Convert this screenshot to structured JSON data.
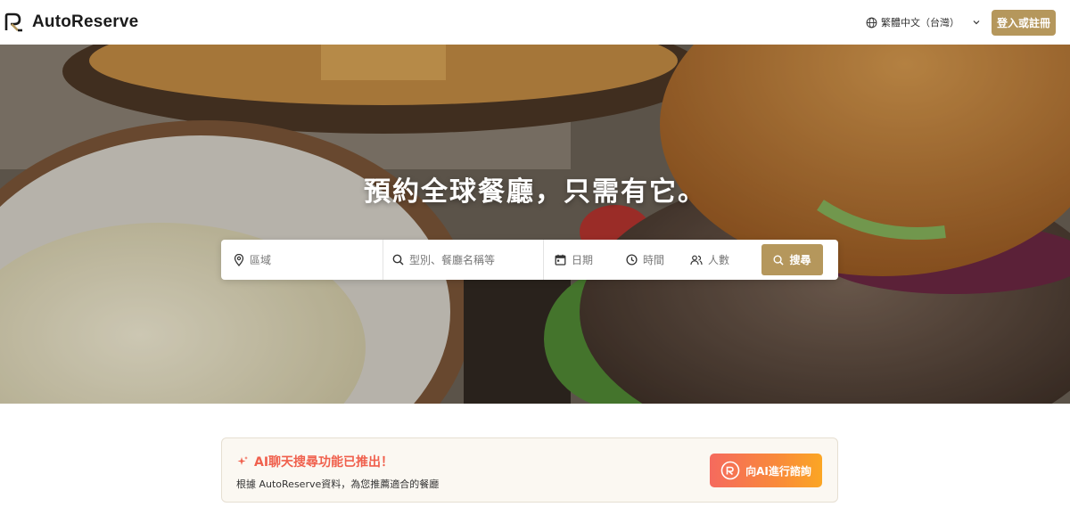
{
  "header": {
    "brand": "AutoReserve",
    "language": "繁體中文（台灣）",
    "login_label": "登入或註冊"
  },
  "hero": {
    "title": "預約全球餐廳，只需有它。"
  },
  "search": {
    "area_placeholder": "區域",
    "type_placeholder": "型別、餐廳名稱等",
    "date_label": "日期",
    "time_label": "時間",
    "people_label": "人數",
    "button_label": "搜尋"
  },
  "ai_banner": {
    "title": "AI聊天搜尋功能已推出！",
    "subtitle": "根據 AutoReserve資料，為您推薦適合的餐廳",
    "button_label": "向AI進行諮詢"
  },
  "colors": {
    "accent": "#b5975c",
    "ai_title": "#f0604d"
  }
}
